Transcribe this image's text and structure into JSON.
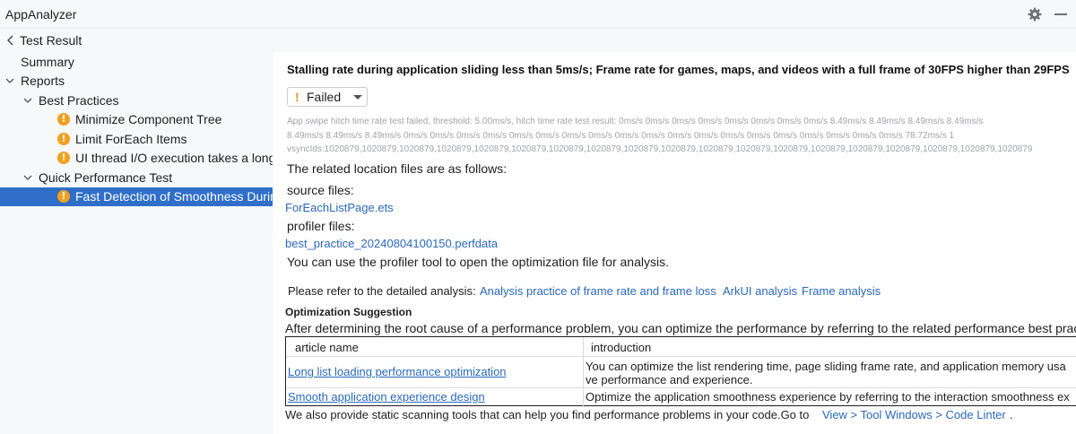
{
  "app": {
    "title": "AppAnalyzer"
  },
  "toolbar": {
    "settings_icon": "gear-icon",
    "minimize_icon": "minus-icon"
  },
  "breadcrumb": {
    "back_icon": "chevron-left-icon",
    "label": "Test Result"
  },
  "tree": {
    "summary": "Summary",
    "reports": "Reports",
    "best_practices": "Best Practices",
    "items_best": [
      "Minimize Component Tree",
      "Limit ForEach Items",
      "UI thread I/O execution takes a long t"
    ],
    "quick_perf": "Quick Performance Test",
    "items_quick": [
      "Fast Detection of Smoothness During"
    ],
    "warning_glyph": "!"
  },
  "main": {
    "heading": "Stalling rate during application sliding less than 5ms/s; Frame rate for games, maps, and videos with a full frame of 30FPS higher than 29FPS",
    "status": {
      "icon": "!",
      "value": "Failed"
    },
    "detail_lines": [
      "App swipe hitch time rate test failed, threshold: 5.00ms/s, hitch time rate test result: 0ms/s 0ms/s 0ms/s 0ms/s 0ms/s 0ms/s 0ms/s 0ms/s 8.49ms/s 8.49ms/s 8.49ms/s 8.49ms/s",
      "8.49ms/s 8.49ms/s 8.49ms/s 0ms/s 0ms/s 0ms/s 0ms/s 0ms/s 0ms/s 0ms/s 0ms/s 0ms/s 0ms/s 0ms/s 0ms/s 0ms/s 0ms/s 0ms/s 0ms/s 0ms/s 0ms/s 0ms/s 78.72ms/s 1",
      "vsyncIds:1020879,1020879,1020879,1020879,1020879,1020879,1020879,1020879,1020879,1020879,1020879,1020879,1020879,1020879,1020879,1020879,1020879,1020879,1020879"
    ],
    "related_intro": "The related location files are as follows:",
    "source_files_label": "source files:",
    "source_file": "ForEachListPage.ets",
    "profiler_files_label": "profiler files:",
    "profiler_file": "best_practice_20240804100150.perfdata",
    "profiler_hint": "You can use the profiler tool to open the optimization file for analysis.",
    "refer_label": "Please refer to the detailed analysis:",
    "refer_links": [
      "Analysis practice of frame rate and frame loss",
      "ArkUI analysis",
      "Frame analysis"
    ],
    "optimization_title": "Optimization Suggestion",
    "optimization_text": "After determining the root cause of a performance problem, you can optimize the performance by referring to the related performance best practice gu",
    "table": {
      "headers": [
        "article name",
        "introduction"
      ],
      "rows": [
        {
          "name": "Long list loading performance optimization",
          "intro_lines": [
            "You can optimize the list rendering time, page sliding frame rate, and application memory usa",
            "ve performance and experience."
          ]
        },
        {
          "name": "Smooth application experience design",
          "intro_lines": [
            "Optimize the application smoothness experience by referring to the interaction smoothness ex"
          ]
        }
      ]
    },
    "footer_text": "We also provide static scanning tools that can help you find performance problems in your code.Go to",
    "footer_link": "View > Tool Windows > Code Linter",
    "footer_end": "."
  }
}
